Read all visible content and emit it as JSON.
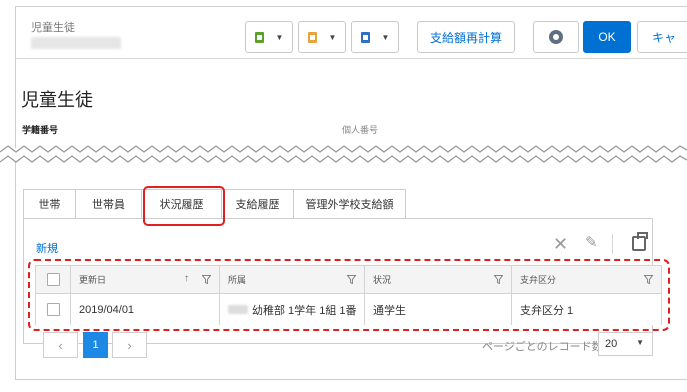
{
  "header": {
    "record_type": "児童生徒",
    "buttons": {
      "recalc_label": "支給額再計算",
      "ok_label": "OK",
      "cancel_label": "キャ"
    },
    "toolbar_icons": [
      {
        "name": "green-doc-icon",
        "color": "#5aa02c"
      },
      {
        "name": "orange-doc-icon",
        "color": "#e8a33a"
      },
      {
        "name": "blue-doc-icon",
        "color": "#2f6fc4"
      }
    ]
  },
  "page": {
    "title": "児童生徒",
    "field_student_number": "学籍番号",
    "field_personal_number": "個人番号"
  },
  "tabs": [
    "世帯",
    "世帯員",
    "状況履歴",
    "支給履歴",
    "管理外学校支給額"
  ],
  "list": {
    "new_label": "新規",
    "columns": [
      "更新日",
      "所属",
      "状況",
      "支弁区分"
    ],
    "rows": [
      {
        "updated": "2019/04/01",
        "affiliation": "幼稚部 1学年 1組 1番",
        "status": "通学生",
        "category": "支弁区分 1"
      }
    ]
  },
  "pager": {
    "prev": "‹",
    "current": "1",
    "next": "›",
    "per_page_label": "ページごとのレコード数",
    "per_page_value": "20"
  },
  "colors": {
    "accent": "#0070d2",
    "highlight": "#e02020",
    "pager_active": "#1e88e5"
  }
}
